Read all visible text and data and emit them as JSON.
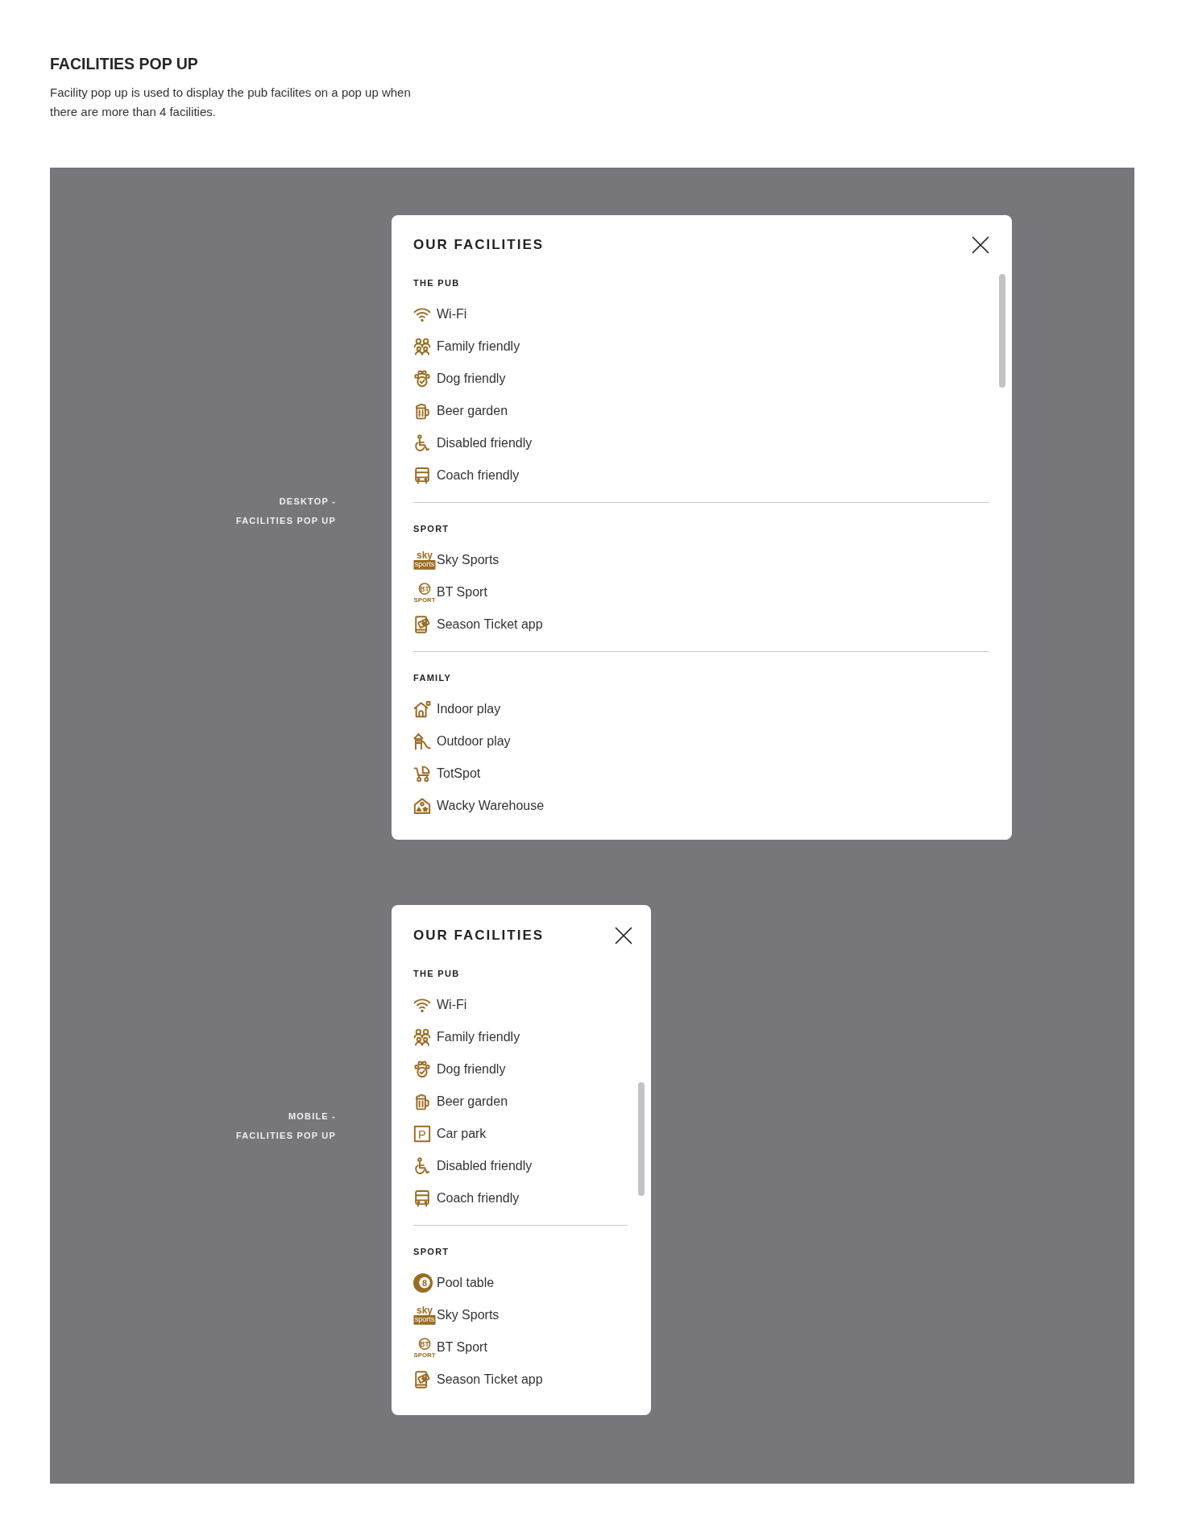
{
  "page": {
    "title": "FACILITIES POP UP",
    "description": "Facility pop up is used to display the pub facilites on a pop up when there are more than 4 facilities."
  },
  "previews": [
    {
      "kind": "desktop",
      "label": [
        "DESKTOP -",
        "FACILITIES POP UP"
      ],
      "popup": {
        "title": "OUR FACILITIES",
        "sections": [
          {
            "heading": "THE PUB",
            "items": [
              {
                "kind": "wifi",
                "label": "Wi-Fi"
              },
              {
                "kind": "family",
                "label": "Family friendly"
              },
              {
                "kind": "dog",
                "label": "Dog friendly"
              },
              {
                "kind": "beer",
                "label": "Beer garden"
              },
              {
                "kind": "wheelchair",
                "label": "Disabled friendly"
              },
              {
                "kind": "coach",
                "label": "Coach friendly"
              }
            ]
          },
          {
            "heading": "SPORT",
            "items": [
              {
                "kind": "sky",
                "label": "Sky Sports",
                "icon_text": [
                  "sky",
                  "sports"
                ]
              },
              {
                "kind": "bt",
                "label": "BT Sport",
                "icon_text": [
                  "BT",
                  "SPORT"
                ]
              },
              {
                "kind": "ticket",
                "label": "Season Ticket app"
              }
            ]
          },
          {
            "heading": "FAMILY",
            "items": [
              {
                "kind": "indoor",
                "label": "Indoor play"
              },
              {
                "kind": "outdoor",
                "label": "Outdoor play"
              },
              {
                "kind": "pram",
                "label": "TotSpot"
              },
              {
                "kind": "warehouse",
                "label": "Wacky Warehouse"
              }
            ]
          }
        ]
      }
    },
    {
      "kind": "mobile",
      "label": [
        "MOBILE -",
        "FACILITIES POP UP"
      ],
      "popup": {
        "title": "OUR FACILITIES",
        "sections": [
          {
            "heading": "THE PUB",
            "items": [
              {
                "kind": "wifi",
                "label": "Wi-Fi"
              },
              {
                "kind": "family",
                "label": "Family friendly"
              },
              {
                "kind": "dog",
                "label": "Dog friendly"
              },
              {
                "kind": "beer",
                "label": "Beer garden"
              },
              {
                "kind": "parking",
                "label": "Car park",
                "icon_text": [
                  "P"
                ]
              },
              {
                "kind": "wheelchair",
                "label": "Disabled friendly"
              },
              {
                "kind": "coach",
                "label": "Coach friendly"
              }
            ]
          },
          {
            "heading": "SPORT",
            "items": [
              {
                "kind": "pool",
                "label": "Pool table",
                "icon_text": [
                  "8"
                ]
              },
              {
                "kind": "sky",
                "label": "Sky Sports",
                "icon_text": [
                  "sky",
                  "sports"
                ]
              },
              {
                "kind": "bt",
                "label": "BT Sport",
                "icon_text": [
                  "BT",
                  "SPORT"
                ]
              },
              {
                "kind": "ticket",
                "label": "Season Ticket app"
              }
            ]
          }
        ]
      }
    }
  ]
}
